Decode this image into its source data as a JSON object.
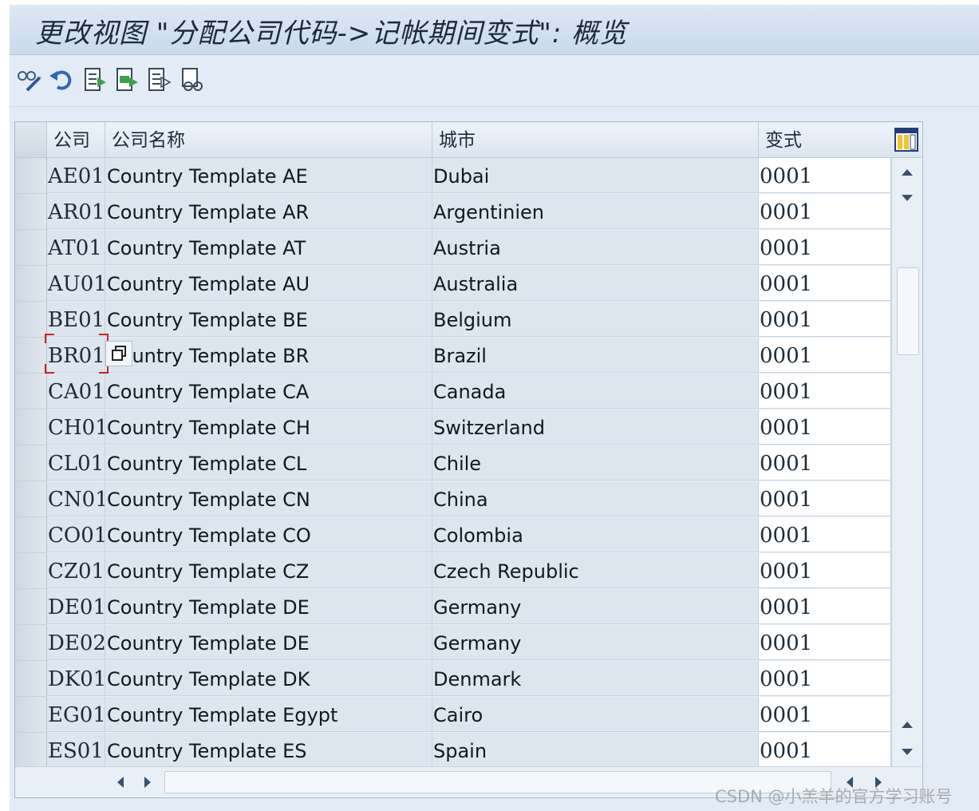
{
  "window": {
    "title": "更改视图 \"分配公司代码->记帐期间变式\": 概览"
  },
  "toolbar": {
    "buttons": [
      {
        "name": "display-change-icon",
        "tooltip": ""
      },
      {
        "name": "undo-icon",
        "tooltip": ""
      },
      {
        "name": "select-all-icon",
        "tooltip": ""
      },
      {
        "name": "select-block-icon",
        "tooltip": ""
      },
      {
        "name": "deselect-all-icon",
        "tooltip": ""
      },
      {
        "name": "find-icon",
        "tooltip": ""
      }
    ]
  },
  "table": {
    "columns": [
      "公司",
      "公司名称",
      "城市",
      "变式"
    ],
    "rows": [
      {
        "code": "AE01",
        "name": "Country Template AE",
        "city": "Dubai",
        "variant": "0001"
      },
      {
        "code": "AR01",
        "name": "Country Template AR",
        "city": "Argentinien",
        "variant": "0001"
      },
      {
        "code": "AT01",
        "name": "Country Template AT",
        "city": "Austria",
        "variant": "0001"
      },
      {
        "code": "AU01",
        "name": "Country Template AU",
        "city": "Australia",
        "variant": "0001"
      },
      {
        "code": "BE01",
        "name": "Country Template BE",
        "city": "Belgium",
        "variant": "0001"
      },
      {
        "code": "BR01",
        "name": "Country Template BR",
        "city": "Brazil",
        "variant": "0001"
      },
      {
        "code": "CA01",
        "name": "Country Template CA",
        "city": "Canada",
        "variant": "0001"
      },
      {
        "code": "CH01",
        "name": "Country Template CH",
        "city": "Switzerland",
        "variant": "0001"
      },
      {
        "code": "CL01",
        "name": "Country Template CL",
        "city": "Chile",
        "variant": "0001"
      },
      {
        "code": "CN01",
        "name": "Country Template CN",
        "city": "China",
        "variant": "0001"
      },
      {
        "code": "CO01",
        "name": "Country Template CO",
        "city": "Colombia",
        "variant": "0001"
      },
      {
        "code": "CZ01",
        "name": "Country Template CZ",
        "city": "Czech Republic",
        "variant": "0001"
      },
      {
        "code": "DE01",
        "name": "Country Template DE",
        "city": "Germany",
        "variant": "0001"
      },
      {
        "code": "DE02",
        "name": "Country Template DE",
        "city": "Germany",
        "variant": "0001"
      },
      {
        "code": "DK01",
        "name": "Country Template DK",
        "city": "Denmark",
        "variant": "0001"
      },
      {
        "code": "EG01",
        "name": "Country Template Egypt",
        "city": "Cairo",
        "variant": "0001"
      },
      {
        "code": "ES01",
        "name": "Country Template ES",
        "city": "Spain",
        "variant": "0001"
      }
    ],
    "focused_row": 5
  },
  "watermark": "CSDN @小羔羊的官方学习账号",
  "colors": {
    "title_bg": "#c9d9ec",
    "toolbar_bg": "#e3ecf6",
    "cell_bg": "#dde6ef",
    "editable_bg": "#ffffff",
    "focus": "#cc2222"
  }
}
